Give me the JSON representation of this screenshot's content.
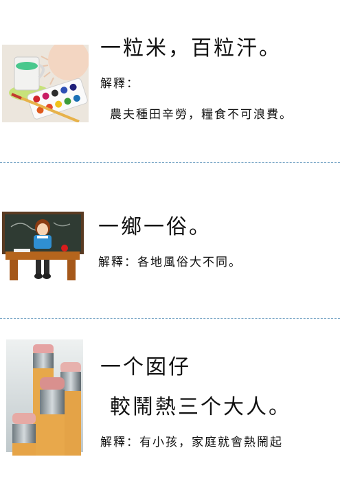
{
  "items": [
    {
      "image_name": "paint-palette-image",
      "title": "一粒米，百粒汗。",
      "label": "解釋：",
      "explanation": "農夫種田辛勞，糧食不可浪費。"
    },
    {
      "image_name": "teacher-chalkboard-image",
      "title": "一鄉一俗。",
      "explanation": "解釋：各地風俗大不同。"
    },
    {
      "image_name": "pencils-image",
      "title_line1": "一个囡仔",
      "title_line2": "較鬧熱三个大人。",
      "explanation": "解釋：有小孩，家庭就會熱鬧起"
    }
  ]
}
